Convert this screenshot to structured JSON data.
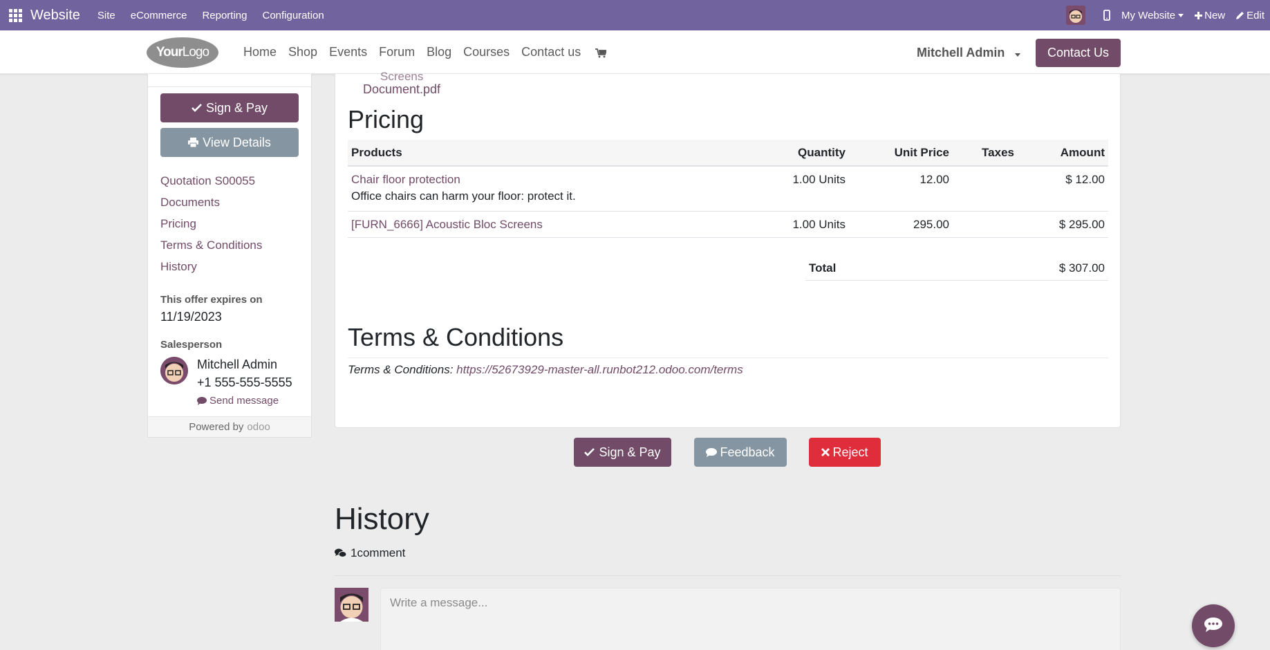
{
  "admin_bar": {
    "brand": "Website",
    "menu": [
      "Site",
      "eCommerce",
      "Reporting",
      "Configuration"
    ],
    "website_selector": "My Website",
    "new_label": "New",
    "edit_label": "Edit",
    "bg_color": "#71639e"
  },
  "site_nav": {
    "logo_bold": "Your",
    "logo_rest": "Logo",
    "links": [
      "Home",
      "Shop",
      "Events",
      "Forum",
      "Blog",
      "Courses",
      "Contact us"
    ],
    "user_name": "Mitchell Admin",
    "contact_button": "Contact Us"
  },
  "sidebar": {
    "sign_pay": "Sign & Pay",
    "view_details": "View Details",
    "nav": [
      "Quotation S00055",
      "Documents",
      "Pricing",
      "Terms & Conditions",
      "History"
    ],
    "expires_label": "This offer expires on",
    "expires_date": "11/19/2023",
    "salesperson_label": "Salesperson",
    "salesperson_name": "Mitchell Admin",
    "salesperson_phone": "+1 555-555-5555",
    "send_message": "Send message",
    "powered_by": "Powered by",
    "odoo": "odoo"
  },
  "main": {
    "partial_doc": "Screens",
    "document_link": "Document.pdf",
    "pricing_title": "Pricing",
    "columns": {
      "products": "Products",
      "quantity": "Quantity",
      "unit_price": "Unit Price",
      "taxes": "Taxes",
      "amount": "Amount"
    },
    "rows": [
      {
        "product": "Chair floor protection",
        "description": "Office chairs can harm your floor: protect it.",
        "quantity": "1.00 Units",
        "unit_price": "12.00",
        "taxes": "",
        "amount": "$ 12.00"
      },
      {
        "product": "[FURN_6666] Acoustic Bloc Screens",
        "description": "",
        "quantity": "1.00 Units",
        "unit_price": "295.00",
        "taxes": "",
        "amount": "$ 295.00"
      }
    ],
    "total_label": "Total",
    "total_value": "$ 307.00",
    "terms_title": "Terms & Conditions",
    "terms_prefix": "Terms & Conditions:",
    "terms_url": "https://52673929-master-all.runbot212.odoo.com/terms"
  },
  "actions": {
    "sign_pay": "Sign & Pay",
    "feedback": "Feedback",
    "reject": "Reject"
  },
  "history": {
    "title": "History",
    "comment_count": "1",
    "comment_label": "comment",
    "message_placeholder": "Write a message..."
  },
  "colors": {
    "primary": "#714b67",
    "secondary": "#8595a2",
    "danger": "#e02d3c"
  }
}
